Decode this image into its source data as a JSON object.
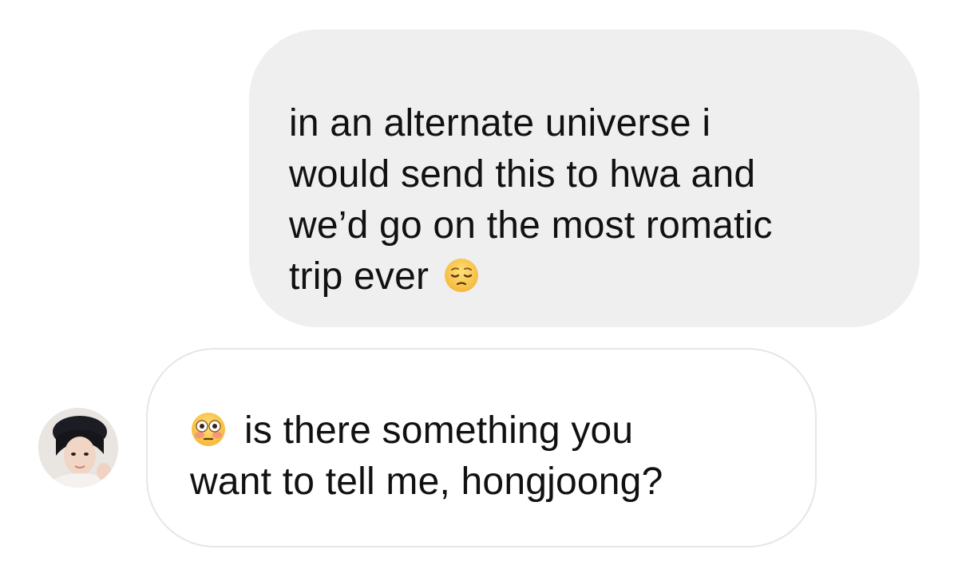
{
  "thread": {
    "sent_message": {
      "lines": [
        "in an alternate universe i",
        "would send this to hwa and",
        "we’d go on the most romatic",
        "trip ever"
      ],
      "trailing_emoji": "pensive-face"
    },
    "received_message": {
      "leading_emoji": "flushed-face",
      "lines": [
        "is there something you",
        "want to tell me, hongjoong?"
      ],
      "sender_avatar": "avatar-photo"
    }
  },
  "colors": {
    "sent_bubble": "#efefef",
    "received_bubble": "#ffffff",
    "received_border": "#e6e6e6",
    "text": "#111111",
    "emoji_yellow": "#f7c23c"
  }
}
